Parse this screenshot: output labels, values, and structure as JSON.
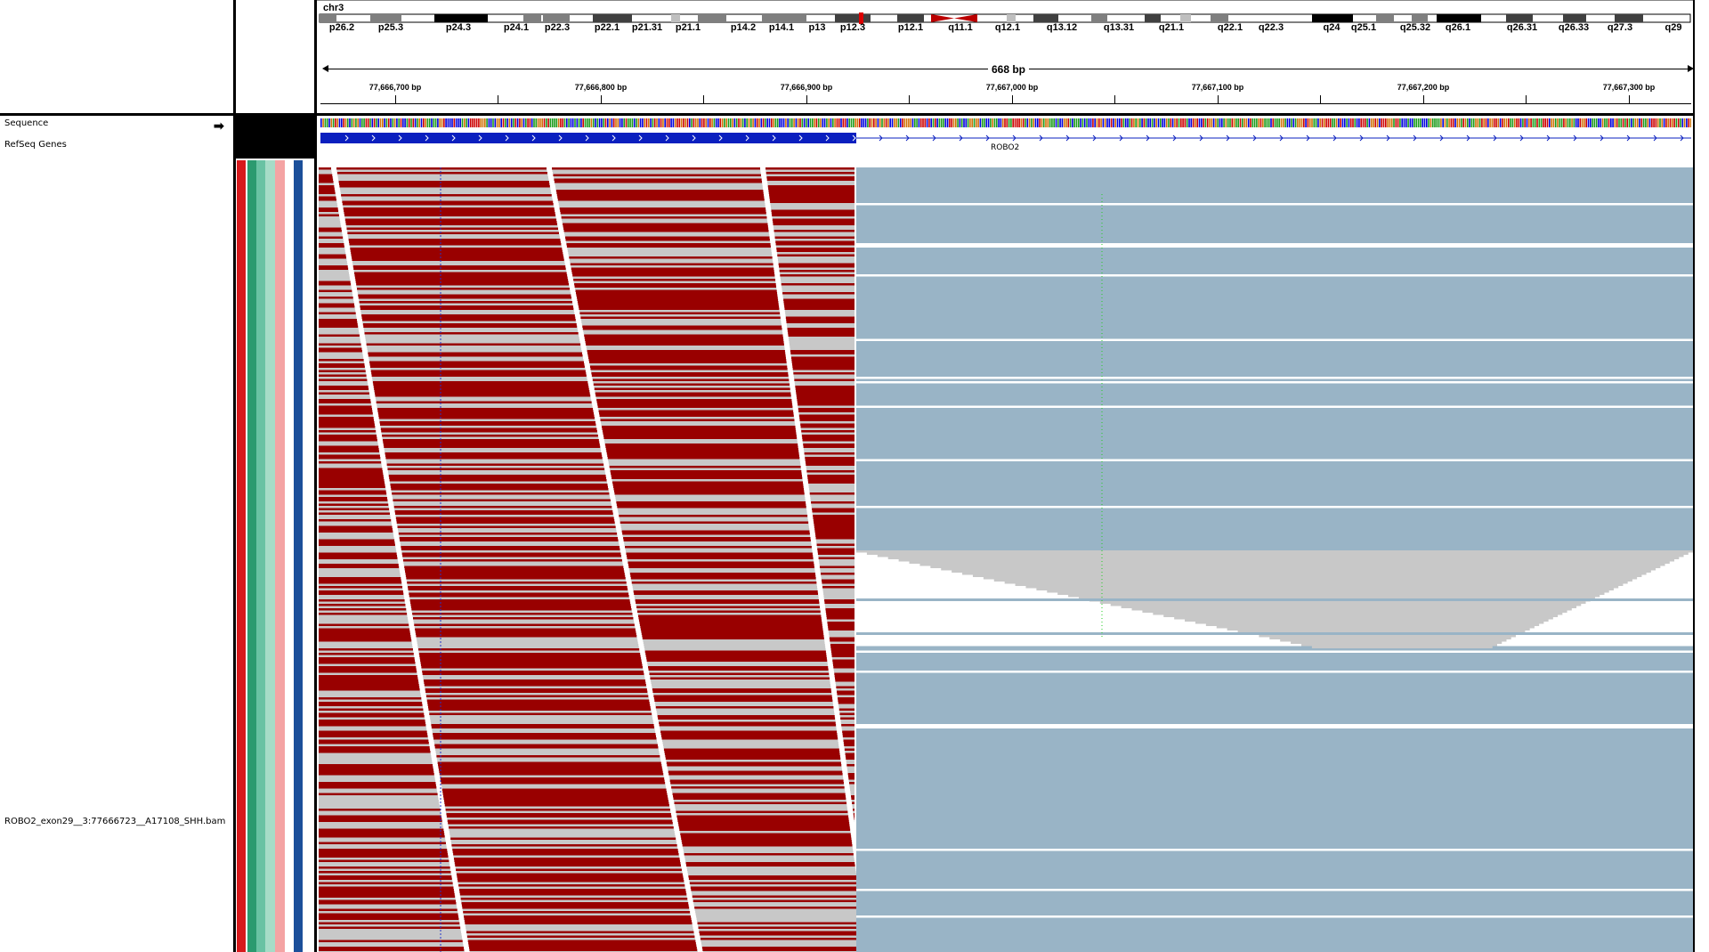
{
  "ideogram": {
    "chromosome": "chr3",
    "bands": [
      "p26.2",
      "p25.3",
      "p24.3",
      "p24.1",
      "p22.3",
      "p22.1",
      "p21.31",
      "p21.1",
      "p14.2",
      "p14.1",
      "p13",
      "p12.3",
      "p12.1",
      "q11.1",
      "q12.1",
      "q13.12",
      "q13.31",
      "q21.1",
      "q22.1",
      "q22.3",
      "q24",
      "q25.1",
      "q25.32",
      "q26.1",
      "q26.31",
      "q26.33",
      "q27.3",
      "q29"
    ]
  },
  "ruler": {
    "span_label": "668 bp",
    "ticks": [
      "77,666,700 bp",
      "77,666,800 bp",
      "77,666,900 bp",
      "77,667,000 bp",
      "77,667,100 bp",
      "77,667,200 bp",
      "77,667,300 bp"
    ]
  },
  "tracks": {
    "sequence_label": "Sequence",
    "sequence_arrow": "➡",
    "refseq_label": "RefSeq Genes",
    "gene_name": "ROBO2",
    "alignment_label": "ROBO2_exon29__3:77666723__A17108_SHH.bam"
  },
  "attribute_colors": [
    "#d7191c",
    "#2b9a6f",
    "#69c2a3",
    "#a6dcc7",
    "#f4a3a3",
    "#ffffff",
    "#1b4f9a"
  ],
  "colors": {
    "read_red": "#990000",
    "read_gray": "#c8c8c8",
    "read_blue": "#99b4c6",
    "gene_blue": "#0a1fbf"
  }
}
